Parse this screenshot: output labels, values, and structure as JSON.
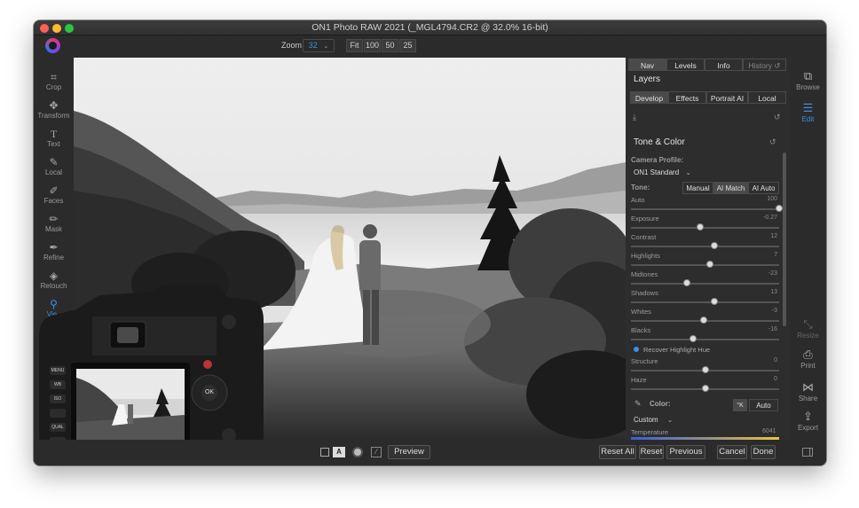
{
  "window": {
    "title": "ON1 Photo RAW 2021 (_MGL4794.CR2 @ 32.0% 16-bit)"
  },
  "toolbar": {
    "zoom_label": "Zoom",
    "zoom_value": "32",
    "fit": "Fit",
    "z100": "100",
    "z50": "50",
    "z25": "25"
  },
  "tools": [
    {
      "label": "Crop",
      "icon": "crop-icon"
    },
    {
      "label": "Transform",
      "icon": "move-icon"
    },
    {
      "label": "Text",
      "icon": "text-icon"
    },
    {
      "label": "Local",
      "icon": "brush-icon"
    },
    {
      "label": "Faces",
      "icon": "face-brush-icon"
    },
    {
      "label": "Mask",
      "icon": "mask-icon"
    },
    {
      "label": "Refine",
      "icon": "refine-icon"
    },
    {
      "label": "Retouch",
      "icon": "retouch-icon"
    },
    {
      "label": "Vie",
      "icon": "view-icon"
    }
  ],
  "right_tools": {
    "browse": "Browse",
    "edit": "Edit",
    "resize": "Resize",
    "print": "Print",
    "share": "Share",
    "export": "Export"
  },
  "panel": {
    "tabs": {
      "nav": "Nav",
      "levels": "Levels",
      "info": "Info",
      "history": "History"
    },
    "layers": "Layers",
    "modules": {
      "develop": "Develop",
      "effects": "Effects",
      "portrait": "Portrait AI",
      "local": "Local"
    },
    "section": "Tone & Color",
    "camera_profile_label": "Camera Profile:",
    "camera_profile": "ON1 Standard",
    "tone_label": "Tone:",
    "tone_buttons": {
      "manual": "Manual",
      "ai_match": "AI Match",
      "ai_auto": "AI Auto"
    },
    "sliders": [
      {
        "name": "Auto",
        "value": "100",
        "pos": 1.0
      },
      {
        "name": "Exposure",
        "value": "-0.27",
        "pos": 0.47
      },
      {
        "name": "Contrast",
        "value": "12",
        "pos": 0.56
      },
      {
        "name": "Highlights",
        "value": "7",
        "pos": 0.53
      },
      {
        "name": "Midtones",
        "value": "-23",
        "pos": 0.38
      },
      {
        "name": "Shadows",
        "value": "13",
        "pos": 0.56
      },
      {
        "name": "Whites",
        "value": "-3",
        "pos": 0.49
      },
      {
        "name": "Blacks",
        "value": "-16",
        "pos": 0.42
      }
    ],
    "recover": "Recover Highlight Hue",
    "sliders2": [
      {
        "name": "Structure",
        "value": "0",
        "pos": 0.5
      },
      {
        "name": "Haze",
        "value": "0",
        "pos": 0.5
      }
    ],
    "color_label": "Color:",
    "kelvin": "°K",
    "auto": "Auto",
    "wb": "Custom",
    "temperature_label": "Temperature",
    "temperature_value": "6041"
  },
  "bottom": {
    "a": "A",
    "preview": "Preview",
    "reset_all": "Reset All",
    "reset": "Reset",
    "previous": "Previous",
    "cancel": "Cancel",
    "done": "Done"
  },
  "camera": {
    "menu": "MENU",
    "wb": "WB",
    "iso": "ISO",
    "qual": "QUAL",
    "ok": "OK"
  },
  "colors": {
    "accent": "#3b8fe8",
    "bg": "#2a2a2a",
    "panel": "#2d2d2d"
  }
}
